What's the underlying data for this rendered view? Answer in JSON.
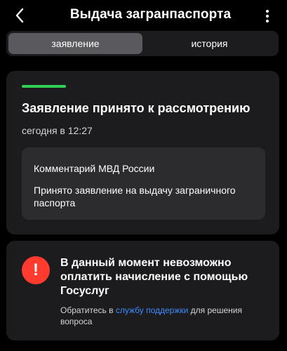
{
  "header": {
    "title": "Выдача загранпаспорта",
    "back_icon": "chevron-left-icon",
    "more_icon": "more-vertical-icon"
  },
  "tabs": [
    {
      "label": "заявление",
      "active": true
    },
    {
      "label": "история",
      "active": false
    }
  ],
  "status_card": {
    "progress_color": "#31d158",
    "title": "Заявление принято к рассмотрению",
    "time": "сегодня в 12:27",
    "comment": {
      "title": "Комментарий МВД России",
      "text": "Принято заявление на выдачу заграничного паспорта"
    }
  },
  "alert_card": {
    "icon": "exclamation-icon",
    "icon_color": "#ff3b30",
    "title": "В данный момент невозможно оплатить начисление с помощью Госуслуг",
    "text_before": "Обратитесь в ",
    "link_text": "службу поддержки",
    "text_after": " для решения вопроса"
  },
  "colors": {
    "background": "#000000",
    "card": "#1c1c1e",
    "link": "#3b8cff"
  }
}
